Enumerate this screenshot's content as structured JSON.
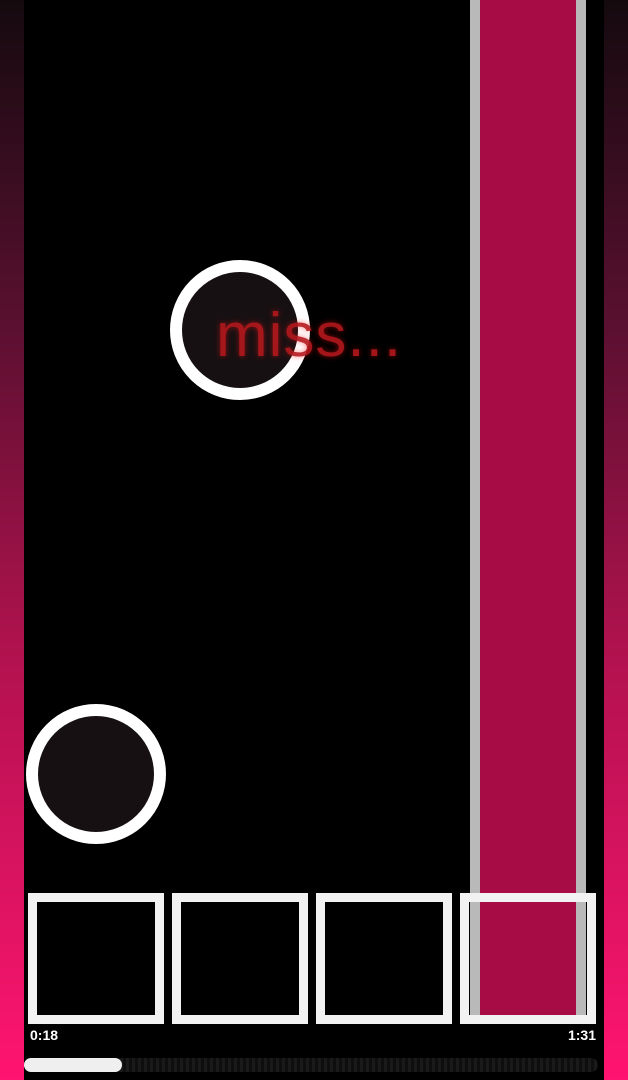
{
  "game": {
    "judgement": "miss...",
    "time_elapsed": "0:18",
    "time_total": "1:31",
    "progress_fraction": 0.17,
    "colors": {
      "accent": "#ff1470",
      "hold_note": "#a80c44",
      "miss_text": "#b5181c",
      "receptor": "#f2f2f2"
    },
    "lanes": 4
  }
}
